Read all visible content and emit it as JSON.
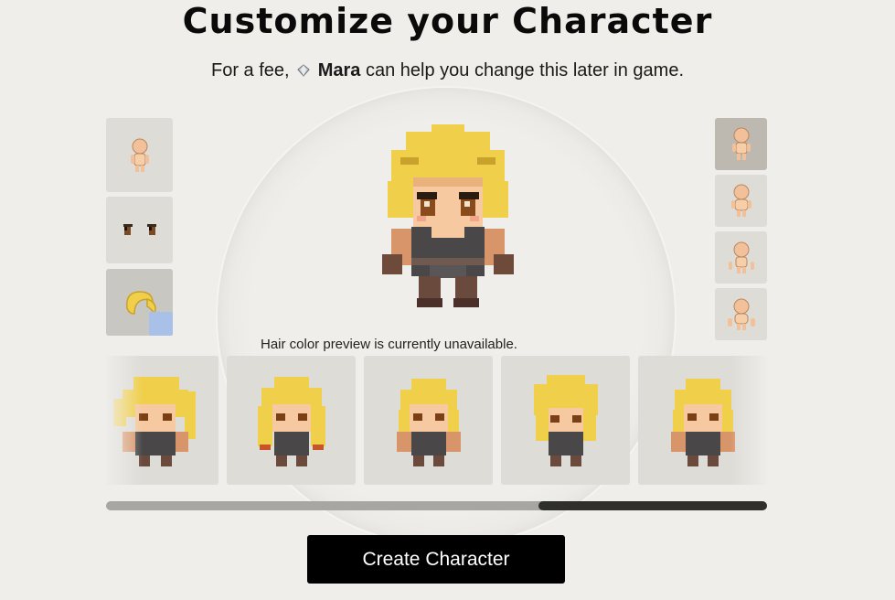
{
  "header": {
    "title": "Customize your Character",
    "subtitle_prefix": "For a fee,",
    "npc_name": "Mara",
    "subtitle_suffix": "can help you change this later in game.",
    "npc_icon": "gem-icon"
  },
  "categories": [
    {
      "icon": "base-body-icon",
      "selected": false
    },
    {
      "icon": "eyes-icon",
      "selected": false
    },
    {
      "icon": "hair-icon",
      "selected": true
    }
  ],
  "body_types": [
    {
      "icon": "body-type-1-icon",
      "selected": true
    },
    {
      "icon": "body-type-2-icon",
      "selected": false
    },
    {
      "icon": "body-type-3-icon",
      "selected": false
    },
    {
      "icon": "body-type-4-icon",
      "selected": false
    }
  ],
  "notice": "Hair color preview is currently unavailable.",
  "hair_styles_count": 5,
  "create_button": "Create Character",
  "colors": {
    "hair": "#f0cf4a",
    "hair_shadow": "#c9a22c",
    "skin": "#f6c9a0",
    "outfit": "#4a4749",
    "button_bg": "#000000"
  }
}
